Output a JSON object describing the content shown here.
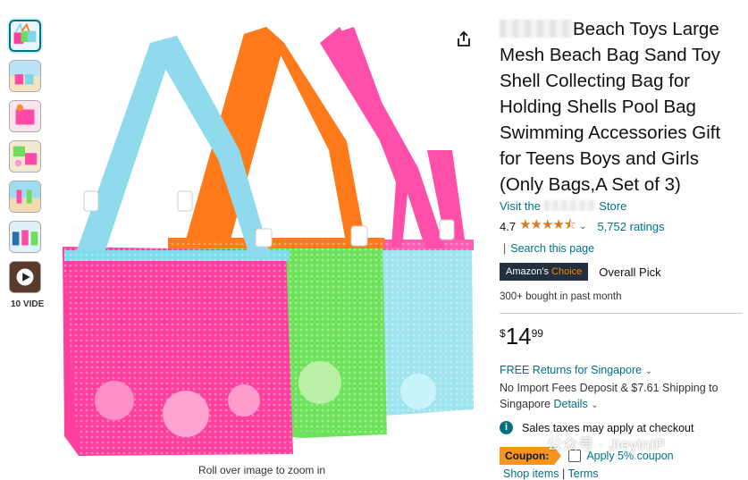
{
  "gallery": {
    "thumbnails": [
      "bags-thumb",
      "beach-thumb",
      "pink-bag-thumb",
      "shells-thumb",
      "kids-thumb",
      "family-thumb",
      "video-thumb"
    ],
    "video_label": "10 VIDE",
    "zoom_hint": "Roll over image to zoom in"
  },
  "product": {
    "title": "Beach Toys Large Mesh Beach Bag Sand Toy Shell Collecting Bag for Holding Shells Pool Bag Swimming Accessories Gift for Teens Boys and Girls (Only Bags,A Set of 3)",
    "store_prefix": "Visit the",
    "store_suffix": "Store",
    "rating": "4.7",
    "ratings_count": "5,752 ratings",
    "search_page": "Search this page",
    "badge_prefix": "Amazon's",
    "badge_highlight": "Choice",
    "badge_label": "Overall Pick",
    "bought": "300+ bought in past month"
  },
  "price": {
    "currency": "$",
    "whole": "14",
    "fraction": "99"
  },
  "shipping": {
    "returns": "FREE Returns for Singapore",
    "fees": "No Import Fees Deposit & $7.61 Shipping to Singapore",
    "details": "Details",
    "tax": "Sales taxes may apply at checkout"
  },
  "coupon": {
    "tag": "Coupon:",
    "label": "Apply 5% coupon",
    "shop_items": "Shop items",
    "terms": "Terms"
  },
  "watermark": "公众号 · JieyinIP",
  "colors": {
    "link": "#007185",
    "star": "#de7921",
    "badge_bg": "#232f3e",
    "badge_accent": "#f08804",
    "coupon": "#f7941d"
  }
}
